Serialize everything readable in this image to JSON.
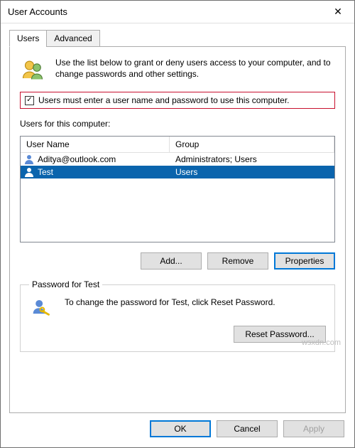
{
  "window": {
    "title": "User Accounts"
  },
  "tabs": {
    "users": "Users",
    "advanced": "Advanced"
  },
  "intro": {
    "text": "Use the list below to grant or deny users access to your computer, and to change passwords and other settings."
  },
  "checkbox": {
    "checked": true,
    "label": "Users must enter a user name and password to use this computer."
  },
  "list": {
    "label": "Users for this computer:",
    "columns": {
      "user": "User Name",
      "group": "Group"
    },
    "rows": [
      {
        "user": "Aditya@outlook.com",
        "group": "Administrators; Users",
        "selected": false
      },
      {
        "user": "Test",
        "group": "Users",
        "selected": true
      }
    ]
  },
  "buttons": {
    "add": "Add...",
    "remove": "Remove",
    "properties": "Properties",
    "reset_password": "Reset Password...",
    "ok": "OK",
    "cancel": "Cancel",
    "apply": "Apply"
  },
  "password_group": {
    "legend": "Password for Test",
    "text": "To change the password for Test, click Reset Password."
  },
  "watermark": "wsxdn.com"
}
